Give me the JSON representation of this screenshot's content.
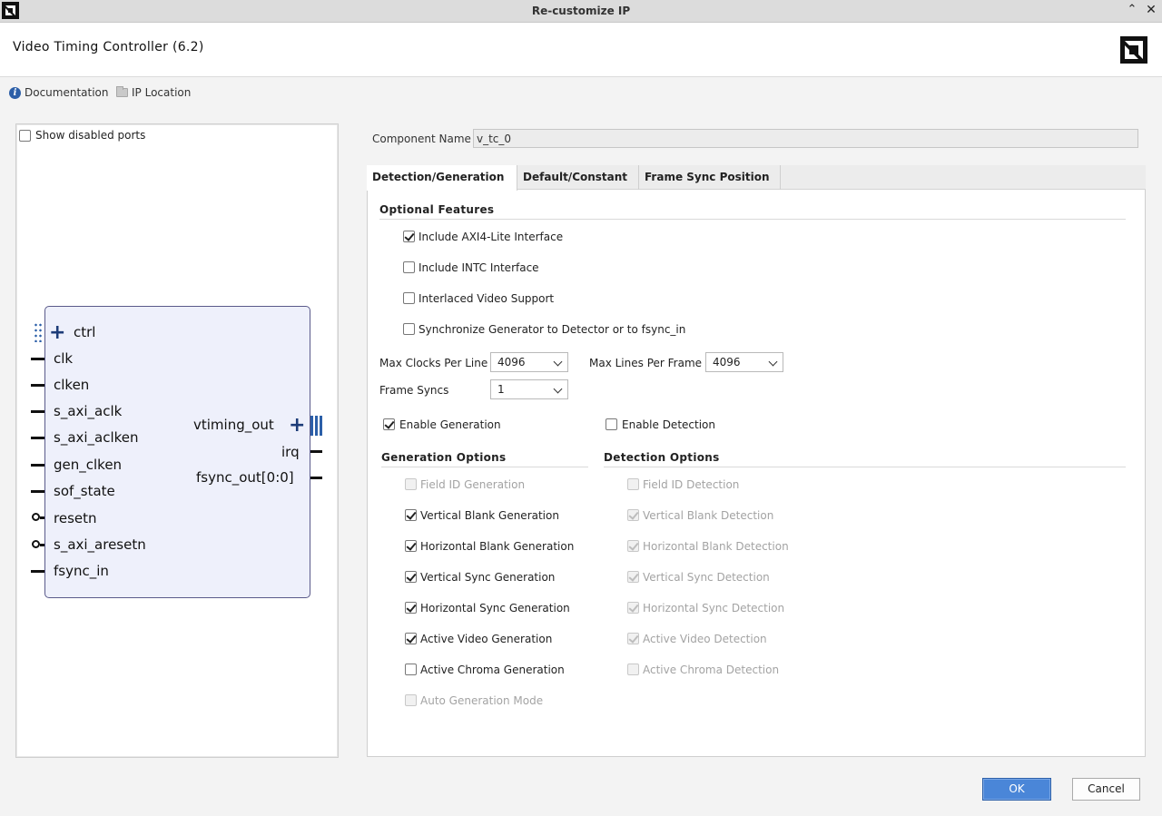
{
  "window": {
    "title": "Re-customize IP",
    "minimize_glyph": "⌃",
    "close_glyph": "✕"
  },
  "header": {
    "ip_title": "Video Timing Controller (6.2)"
  },
  "links": {
    "documentation": "Documentation",
    "ip_location": "IP Location"
  },
  "left_panel": {
    "show_disabled_ports": {
      "label": "Show disabled ports",
      "checked": false
    },
    "block": {
      "bus_port": "ctrl",
      "inputs": [
        "clk",
        "clken",
        "s_axi_aclk",
        "s_axi_aclken",
        "gen_clken",
        "sof_state",
        "resetn",
        "s_axi_aresetn",
        "fsync_in"
      ],
      "outputs": [
        "vtiming_out",
        "irq",
        "fsync_out[0:0]"
      ]
    }
  },
  "component": {
    "label": "Component Name",
    "value": "v_tc_0"
  },
  "tabs": [
    {
      "label": "Detection/Generation",
      "active": true
    },
    {
      "label": "Default/Constant",
      "active": false
    },
    {
      "label": "Frame Sync Position",
      "active": false
    }
  ],
  "optional_features": {
    "title": "Optional Features",
    "items": [
      {
        "label": "Include AXI4-Lite Interface",
        "checked": true
      },
      {
        "label": "Include INTC Interface",
        "checked": false
      },
      {
        "label": "Interlaced Video Support",
        "checked": false
      },
      {
        "label": "Synchronize Generator to Detector or to fsync_in",
        "checked": false
      }
    ]
  },
  "params": {
    "max_clocks": {
      "label": "Max Clocks Per Line",
      "value": "4096"
    },
    "max_lines": {
      "label": "Max Lines Per Frame",
      "value": "4096"
    },
    "frame_syncs": {
      "label": "Frame Syncs",
      "value": "1"
    }
  },
  "enable_generation": {
    "label": "Enable Generation",
    "checked": true
  },
  "enable_detection": {
    "label": "Enable Detection",
    "checked": false
  },
  "generation_options": {
    "title": "Generation Options",
    "items": [
      {
        "label": "Field ID Generation",
        "checked": false,
        "disabled": true
      },
      {
        "label": "Vertical Blank Generation",
        "checked": true,
        "disabled": false
      },
      {
        "label": "Horizontal Blank Generation",
        "checked": true,
        "disabled": false
      },
      {
        "label": "Vertical Sync Generation",
        "checked": true,
        "disabled": false
      },
      {
        "label": "Horizontal Sync Generation",
        "checked": true,
        "disabled": false
      },
      {
        "label": "Active Video Generation",
        "checked": true,
        "disabled": false
      },
      {
        "label": "Active Chroma Generation",
        "checked": false,
        "disabled": false
      },
      {
        "label": "Auto Generation Mode",
        "checked": false,
        "disabled": true
      }
    ]
  },
  "detection_options": {
    "title": "Detection Options",
    "items": [
      {
        "label": "Field ID Detection",
        "checked": false,
        "disabled": true
      },
      {
        "label": "Vertical Blank Detection",
        "checked": true,
        "disabled": true
      },
      {
        "label": "Horizontal Blank Detection",
        "checked": true,
        "disabled": true
      },
      {
        "label": "Vertical Sync Detection",
        "checked": true,
        "disabled": true
      },
      {
        "label": "Horizontal Sync Detection",
        "checked": true,
        "disabled": true
      },
      {
        "label": "Active Video Detection",
        "checked": true,
        "disabled": true
      },
      {
        "label": "Active Chroma Detection",
        "checked": false,
        "disabled": true
      }
    ]
  },
  "buttons": {
    "ok": "OK",
    "cancel": "Cancel"
  },
  "colors": {
    "accent": "#4a86d8",
    "block_fill": "#eef0fb",
    "bus": "#2c5fa8"
  }
}
